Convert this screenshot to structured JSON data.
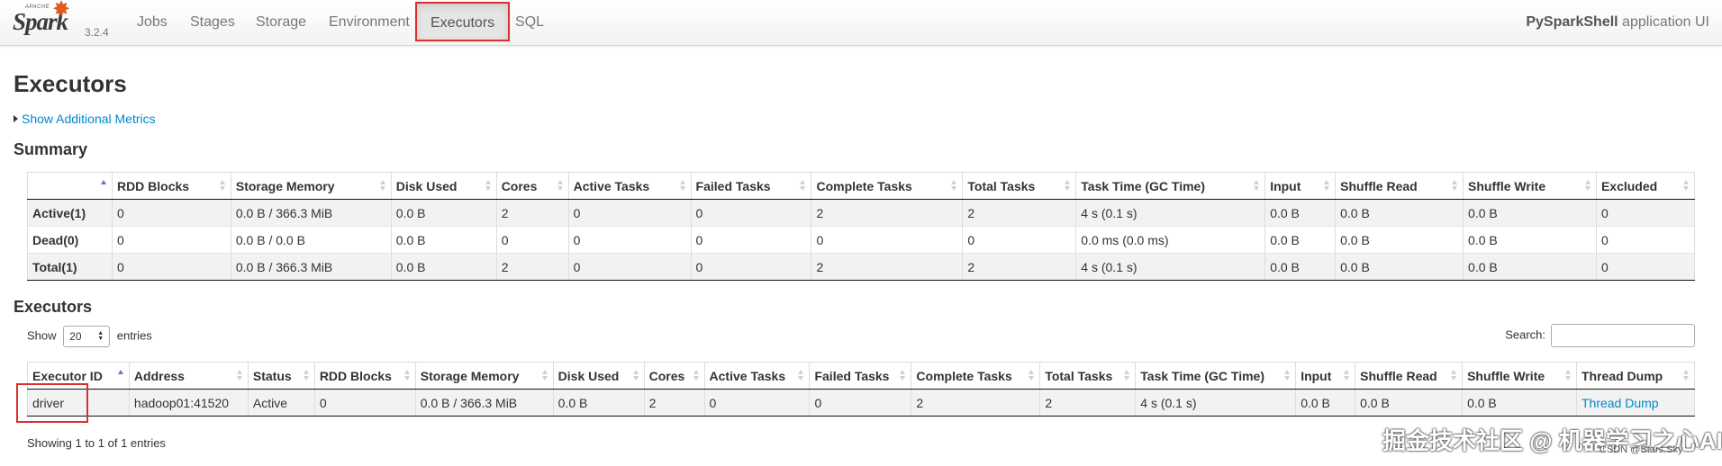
{
  "navbar": {
    "logo_small": "APACHE",
    "logo_text": "Spark",
    "version": "3.2.4",
    "links": [
      "Jobs",
      "Stages",
      "Storage",
      "Environment",
      "Executors",
      "SQL"
    ],
    "app_name": "PySparkShell",
    "app_suffix": " application UI"
  },
  "page": {
    "title": "Executors",
    "show_metrics": "Show Additional Metrics",
    "summary_heading": "Summary",
    "executors_heading": "Executors"
  },
  "summary": {
    "headers": [
      "",
      "RDD Blocks",
      "Storage Memory",
      "Disk Used",
      "Cores",
      "Active Tasks",
      "Failed Tasks",
      "Complete Tasks",
      "Total Tasks",
      "Task Time (GC Time)",
      "Input",
      "Shuffle Read",
      "Shuffle Write",
      "Excluded"
    ],
    "rows": [
      [
        "Active(1)",
        "0",
        "0.0 B / 366.3 MiB",
        "0.0 B",
        "2",
        "0",
        "0",
        "2",
        "2",
        "4 s (0.1 s)",
        "0.0 B",
        "0.0 B",
        "0.0 B",
        "0"
      ],
      [
        "Dead(0)",
        "0",
        "0.0 B / 0.0 B",
        "0.0 B",
        "0",
        "0",
        "0",
        "0",
        "0",
        "0.0 ms (0.0 ms)",
        "0.0 B",
        "0.0 B",
        "0.0 B",
        "0"
      ],
      [
        "Total(1)",
        "0",
        "0.0 B / 366.3 MiB",
        "0.0 B",
        "2",
        "0",
        "0",
        "2",
        "2",
        "4 s (0.1 s)",
        "0.0 B",
        "0.0 B",
        "0.0 B",
        "0"
      ]
    ]
  },
  "table_controls": {
    "show_label": "Show",
    "entries_value": "20",
    "entries_label": "entries",
    "search_label": "Search:",
    "search_value": "",
    "showing_text": "Showing 1 to 1 of 1 entries"
  },
  "executors": {
    "headers": [
      "Executor ID",
      "Address",
      "Status",
      "RDD Blocks",
      "Storage Memory",
      "Disk Used",
      "Cores",
      "Active Tasks",
      "Failed Tasks",
      "Complete Tasks",
      "Total Tasks",
      "Task Time (GC Time)",
      "Input",
      "Shuffle Read",
      "Shuffle Write",
      "Thread Dump"
    ],
    "rows": [
      [
        "driver",
        "hadoop01:41520",
        "Active",
        "0",
        "0.0 B / 366.3 MiB",
        "0.0 B",
        "2",
        "0",
        "0",
        "2",
        "2",
        "4 s (0.1 s)",
        "0.0 B",
        "0.0 B",
        "0.0 B",
        "Thread Dump"
      ]
    ]
  },
  "watermark": {
    "main": "掘金技术社区 @ 机器学习之心AI",
    "sub": "CSDN @Stars.Sky"
  },
  "colors": {
    "link": "#0088cc",
    "highlight": "#d9302c",
    "spark_orange": "#e25a1c"
  }
}
